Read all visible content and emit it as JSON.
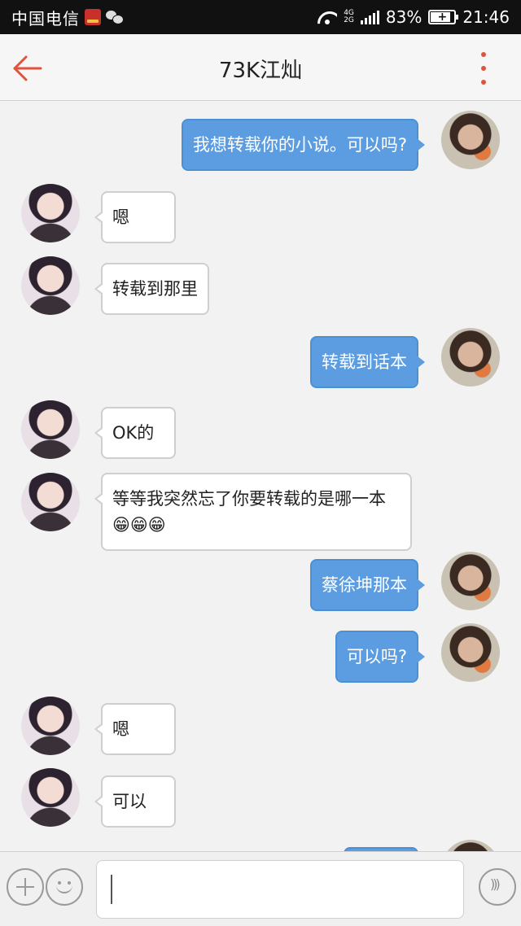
{
  "status_bar": {
    "carrier": "中国电信",
    "net_type_top": "4G",
    "net_type_bottom": "2G",
    "battery_percent": "83%",
    "time": "21:46",
    "battery_level": 0.83
  },
  "header": {
    "title": "73K江灿",
    "accent_color": "#e0533c"
  },
  "messages": [
    {
      "side": "right",
      "text": "我想转载你的小说。可以吗?"
    },
    {
      "side": "left",
      "text": "嗯"
    },
    {
      "side": "left",
      "text": "转载到那里"
    },
    {
      "side": "right",
      "text": "转载到话本"
    },
    {
      "side": "left",
      "text": "OK的"
    },
    {
      "side": "left",
      "text": "等等我突然忘了你要转载的是哪一本😁😁😁"
    },
    {
      "side": "right",
      "text": "蔡徐坤那本"
    },
    {
      "side": "right",
      "text": "可以吗?"
    },
    {
      "side": "left",
      "text": "嗯"
    },
    {
      "side": "left",
      "text": "可以"
    }
  ],
  "input_bar": {
    "message_value": "",
    "icons": [
      "plus-icon",
      "emoji-icon",
      "voice-icon"
    ]
  },
  "colors": {
    "sent_bubble": "#5b9de0",
    "received_bubble": "#ffffff"
  }
}
